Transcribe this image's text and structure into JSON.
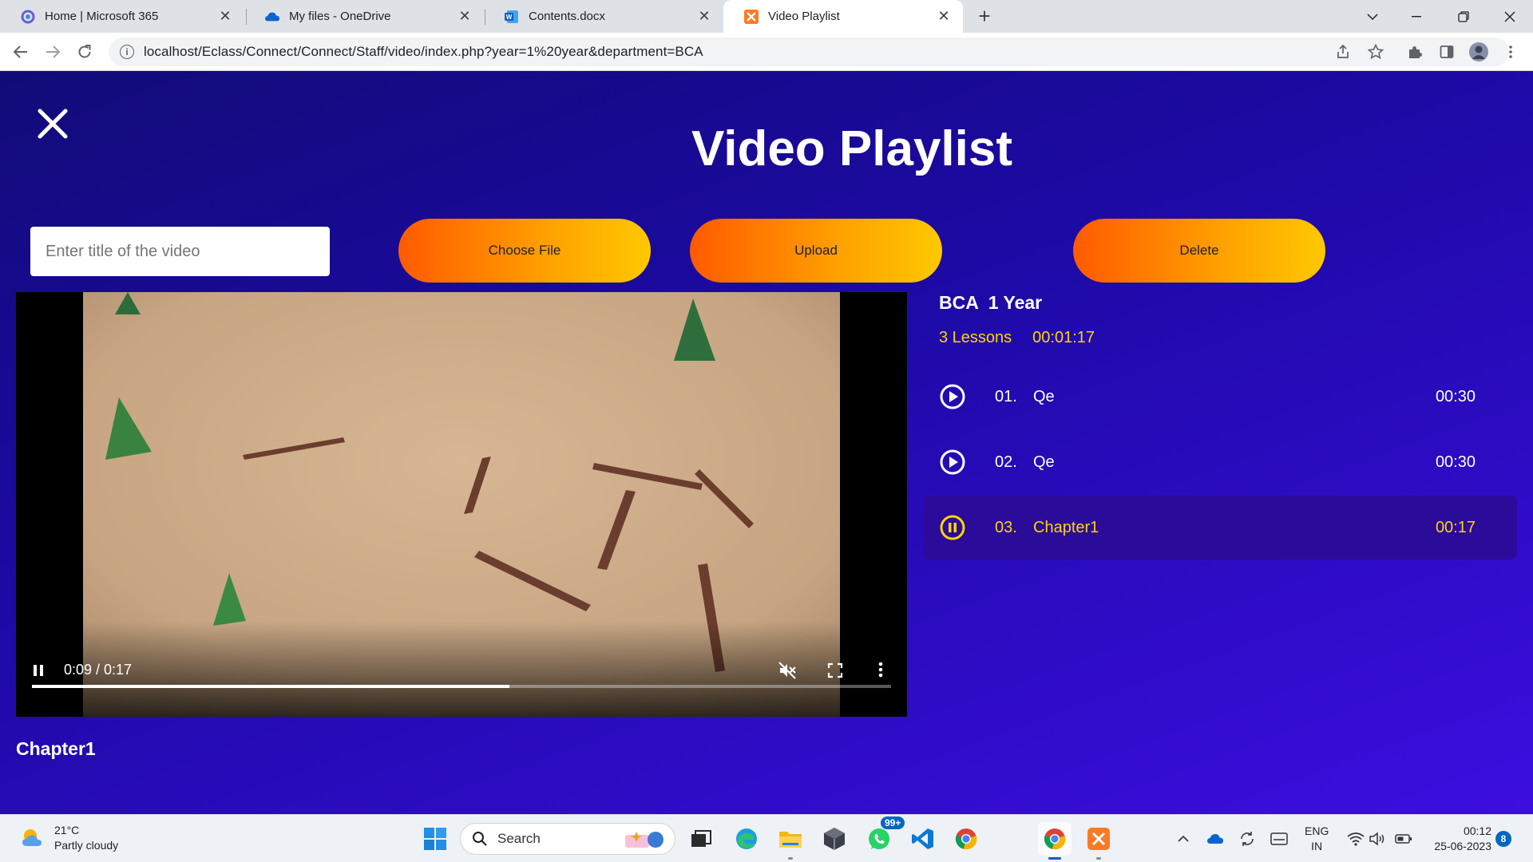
{
  "browser": {
    "tabs": [
      {
        "title": "Home | Microsoft 365",
        "icon": "microsoft365-icon",
        "active": false
      },
      {
        "title": "My files - OneDrive",
        "icon": "onedrive-icon",
        "active": false
      },
      {
        "title": "Contents.docx",
        "icon": "word-icon",
        "active": false
      },
      {
        "title": "Video Playlist",
        "icon": "xampp-icon",
        "active": true
      }
    ],
    "url": "localhost/Eclass/Connect/Connect/Staff/video/index.php?year=1%20year&department=BCA"
  },
  "page": {
    "title": "Video Playlist",
    "title_input_placeholder": "Enter title of the video",
    "buttons": {
      "choose_file": "Choose File",
      "upload": "Upload",
      "delete": "Delete"
    }
  },
  "video": {
    "current_time": "0:09",
    "duration": "0:17",
    "time_display": "0:09 / 0:17",
    "progress": 0.556,
    "muted": true,
    "caption": "Chapter1"
  },
  "playlist": {
    "course": "BCA  1 Year",
    "lesson_count": "3 Lessons",
    "total_duration": "00:01:17",
    "items": [
      {
        "number": "01.",
        "name": "Qe",
        "duration": "00:30",
        "state": "play"
      },
      {
        "number": "02.",
        "name": "Qe",
        "duration": "00:30",
        "state": "play"
      },
      {
        "number": "03.",
        "name": "Chapter1",
        "duration": "00:17",
        "state": "pause"
      }
    ]
  },
  "colors": {
    "accent_yellow": "#ffd400",
    "button_gradient_start": "#ff5a00",
    "button_gradient_end": "#ffc800",
    "page_bg": "#1e0aa8"
  },
  "taskbar": {
    "weather_temp": "21°C",
    "weather_desc": "Partly cloudy",
    "search_label": "Search",
    "whatsapp_badge": "99+",
    "lang_line1": "ENG",
    "lang_line2": "IN",
    "time": "00:12",
    "date": "25-06-2023",
    "notification_count": "8"
  }
}
